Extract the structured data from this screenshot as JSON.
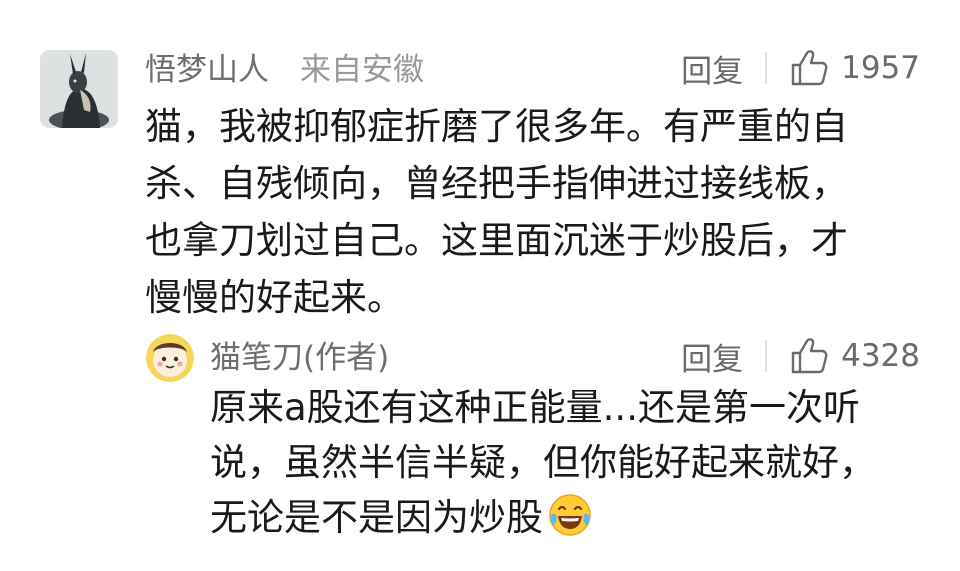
{
  "comment": {
    "author": "悟梦山人",
    "from": "来自安徽",
    "reply_label": "回复",
    "like_count": "1957",
    "lines": [
      "猫，我被抑郁症折磨了很多年。有严重的自",
      "杀、自残倾向，曾经把手指伸进过接线板，",
      "也拿刀划过自己。这里面沉迷于炒股后，才",
      "慢慢的好起来。"
    ]
  },
  "reply": {
    "author": "猫笔刀(作者)",
    "reply_label": "回复",
    "like_count": "4328",
    "lines": [
      "原来a股还有这种正能量...还是第一次听",
      "说，虽然半信半疑，但你能好起来就好，",
      "无论是不是因为炒股"
    ],
    "trailing_emoji": "laughing-tears-icon"
  },
  "colors": {
    "name": "#6e6e6e",
    "meta": "#9a9a9a",
    "body": "#1a1a1a",
    "divider": "#e1e1e1"
  }
}
